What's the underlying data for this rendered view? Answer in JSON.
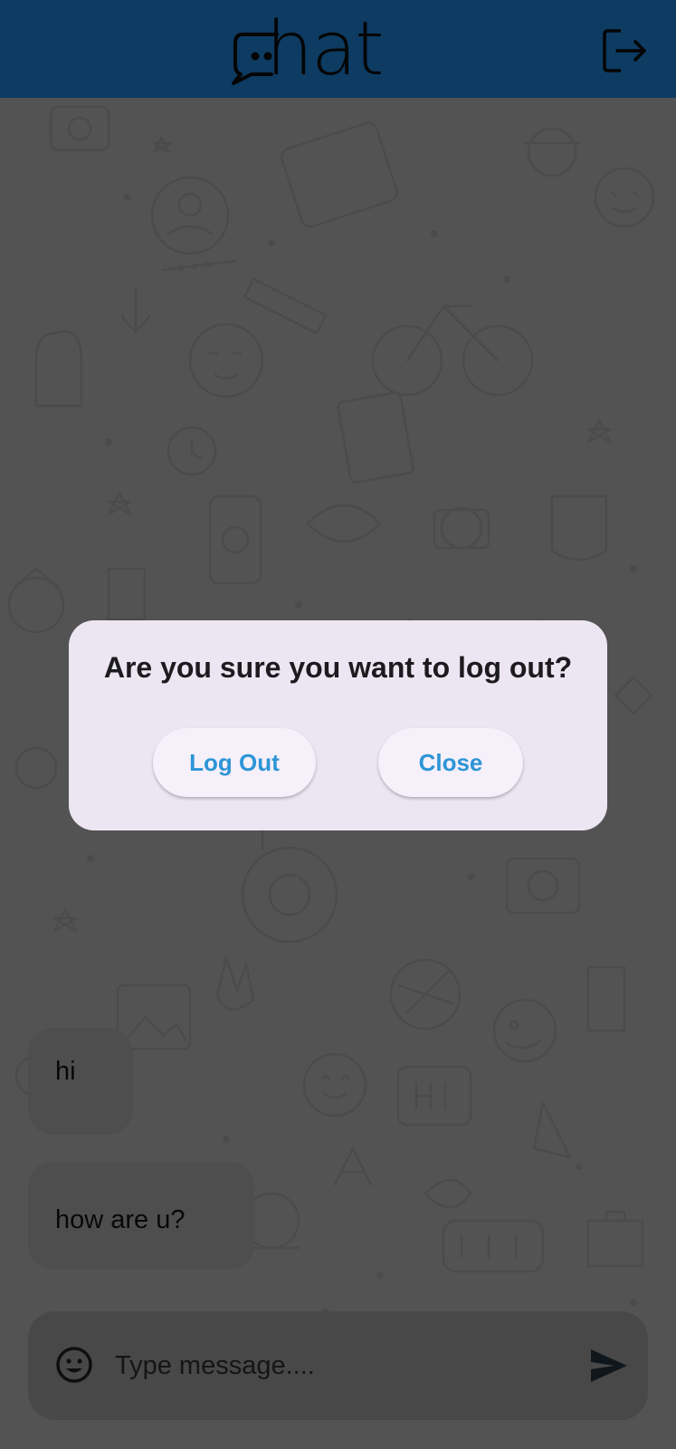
{
  "app": {
    "logo_text": "hat"
  },
  "messages": [
    {
      "text": "hi"
    },
    {
      "text": "how are u?"
    }
  ],
  "composer": {
    "placeholder": "Type message...."
  },
  "dialog": {
    "title": "Are you sure you want to log out?",
    "logout_label": "Log Out",
    "close_label": "Close"
  },
  "icons": {
    "logo": "chat-bubble-icon",
    "logout": "logout-icon",
    "emoji": "emoji-icon",
    "send": "send-icon"
  },
  "colors": {
    "appbar": "#1b76c4",
    "dialog_bg": "#ece6f3",
    "button_text": "#2d95d6"
  }
}
